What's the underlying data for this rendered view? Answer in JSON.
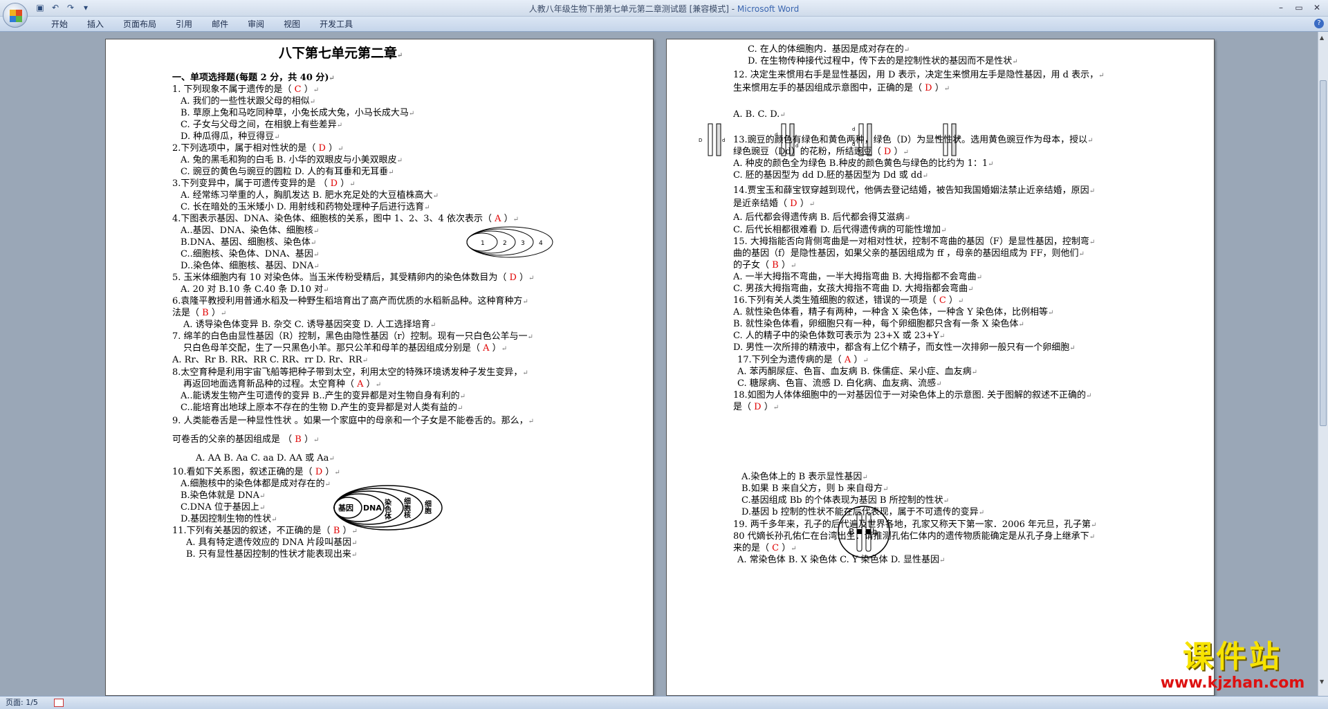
{
  "window": {
    "title": "人教八年级生物下册第七单元第二章测试题 [兼容模式] - ",
    "app": "Microsoft Word"
  },
  "ribbon": {
    "tabs": [
      "开始",
      "插入",
      "页面布局",
      "引用",
      "邮件",
      "审阅",
      "视图",
      "开发工具"
    ]
  },
  "status": {
    "page": "页面: 1/5"
  },
  "watermark": {
    "title": "课件站",
    "url": "www.kjzhan.com"
  },
  "page1": {
    "lines": [
      {
        "t": "八下第七单元第二章",
        "c": "ttl"
      },
      {
        "t": "一、单项选择题(每题 2 分，共 40 分)",
        "c": "sec"
      },
      {
        "t": "1. 下列现象不属于遗传的是（",
        "a": "C",
        "z": "）"
      },
      {
        "t": "A. 我们的一些性状跟父母的相似"
      },
      {
        "t": "B. 草原上兔和马吃同种草，小兔长成大兔，小马长成大马"
      },
      {
        "t": "C. 子女与父母之间，在相貌上有些差异"
      },
      {
        "t": "D. 种瓜得瓜，种豆得豆"
      },
      {
        "t": "2.下列选项中，属于相对性状的是（",
        "a": "D",
        "z": "）"
      },
      {
        "t": "A. 兔的黑毛和狗的白毛          B.  小华的双眼皮与小美双眼皮"
      },
      {
        "t": "C. 豌豆的黄色与豌豆的圆粒        D.  人的有耳垂和无耳垂"
      },
      {
        "t": "3.下列变异中，属于可遗传变异的是 （",
        "a": "D",
        "z": "）"
      },
      {
        "t": "A. 经常练习举重的人，胸肌发达       B. 肥水充足处的大豆植株高大"
      },
      {
        "t": "C. 长在暗处的玉米矮小             D. 用射线和药物处理种子后进行选育"
      },
      {
        "t": "4.下图表示基因、DNA、染色体、细胞核的关系，图中 1、2、3、4 依次表示（",
        "a": "A",
        "z": "）"
      },
      {
        "t": "A..基因、DNA、染色体、细胞核"
      },
      {
        "t": "B.DNA、基因、细胞核、染色体"
      },
      {
        "t": "C..细胞核、染色体、DNA、基因"
      },
      {
        "t": "D..染色体、细胞核、基因、DNA"
      },
      {
        "t": "5. 玉米体细胞内有 10 对染色体。当玉米传粉受精后，其受精卵内的染色体数目为（",
        "a": "D",
        "z": "）"
      },
      {
        "t": "A. 20 对        B.10 条        C.40 条        D.10 对"
      },
      {
        "t": "6.袁隆平教授利用普通水稻及一种野生稻培育出了高产而优质的水稻新品种。这种育种方"
      },
      {
        "t": "法是（",
        "a": "B",
        "z": "）"
      },
      {
        "t": "A. 诱导染色体变异      B. 杂交       C. 诱导基因突变       D. 人工选择培育"
      },
      {
        "t": "7. 绵羊的白色由显性基因（R）控制，黑色由隐性基因（r）控制。现有一只白色公羊与一"
      },
      {
        "t": "只白色母羊交配，生了一只黑色小羊。那只公羊和母羊的基因组成分别是（",
        "a": "A",
        "z": "）"
      },
      {
        "t": "A. Rr、Rr          B. RR、RR          C. RR、rr          D. Rr、RR"
      },
      {
        "t": "8.太空育种是利用宇宙飞船等把种子带到太空，利用太空的特殊环境诱发种子发生变异，"
      },
      {
        "t": "再返回地面选育新品种的过程。太空育种（",
        "a": "A",
        "z": "）"
      },
      {
        "t": "A..能诱发生物产生可遗传的变异             B..产生的变异都是对生物自身有利的"
      },
      {
        "t": "C..能培育出地球上原本不存在的生物         D.产生的变异都是对人类有益的"
      },
      {
        "t": "9. 人类能卷舌是一种显性性状 。如果一个家庭中的母亲和一个子女是不能卷舌的。那么，"
      },
      {
        "t": "可卷舌的父亲的基因组成是       （",
        "a": "B",
        "z": "）"
      },
      {
        "t": "A.  AA             B. Aa            C.  aa             D. AA 或 Aa"
      },
      {
        "t": "10.看如下关系图，叙述正确的是（",
        "a": "D",
        "z": "）"
      },
      {
        "t": "A.细胞核中的染色体都是成对存在的"
      },
      {
        "t": "B.染色体就是 DNA"
      },
      {
        "t": "C.DNA 位于基因上"
      },
      {
        "t": "D.基因控制生物的性状"
      },
      {
        "t": "11.下列有关基因的叙述，不正确的是（",
        "a": "B",
        "z": "）"
      },
      {
        "t": "A. 具有特定遗传效应的 DNA 片段叫基因"
      },
      {
        "t": "B. 只有显性基因控制的性状才能表现出来"
      }
    ],
    "fig4": [
      "1",
      "2",
      "3",
      "4"
    ],
    "fig10": [
      "基因",
      "DNA",
      "染色体",
      "细胞核",
      "细胞"
    ]
  },
  "page2": {
    "lines": [
      {
        "t": "C. 在人的体细胞内．基因是成对存在的"
      },
      {
        "t": "D. 在生物传种接代过程中，传下去的是控制性状的基因而不是性状"
      },
      {
        "t": "12. 决定生来惯用右手是显性基因，用 D 表示，决定生来惯用左手是隐性基因，用 d 表示，"
      },
      {
        "t": "生来惯用左手的基因组成示意图中，正确的是（",
        "a": "D",
        "z": "）"
      },
      {
        "t": "A.               B.               C.               D."
      },
      {
        "t": "13.豌豆的颜色有绿色和黄色两种，绿色（D）为显性性状。选用黄色豌豆作为母本，授以"
      },
      {
        "t": "绿色豌豆（Dd）的花粉，所结豌豆（",
        "a": "D",
        "z": "）"
      },
      {
        "t": "A. 种皮的颜色全为绿色                          B.种皮的颜色黄色与绿色的比约为 1：1"
      },
      {
        "t": "C. 胚的基因型为 dd                             D.胚的基因型为 Dd 或 dd"
      },
      {
        "t": "14.贾宝玉和薛宝钗穿越到现代，他俩去登记结婚，被告知我国婚姻法禁止近亲结婚，原因"
      },
      {
        "t": "是近亲结婚（",
        "a": "D",
        "z": "）"
      },
      {
        "t": "A. 后代都会得遗传病                 B. 后代都会得艾滋病"
      },
      {
        "t": "C. 后代长相都很难看                 D. 后代得遗传病的可能性增加"
      },
      {
        "t": "15. 大拇指能否向背侧弯曲是一对相对性状，控制不弯曲的基因（F）是显性基因，控制弯"
      },
      {
        "t": "曲的基因（f）是隐性基因，如果父亲的基因组成为  ff   ，母亲的基因组成为 FF，则他们"
      },
      {
        "t": "的子女（",
        "a": "B",
        "z": "）"
      },
      {
        "t": "A. 一半大拇指不弯曲，一半大拇指弯曲      B. 大拇指都不会弯曲"
      },
      {
        "t": "C. 男孩大拇指弯曲，女孩大拇指不弯曲      D. 大拇指都会弯曲"
      },
      {
        "t": "16.下列有关人类生殖细胞的叙述，错误的一项是（",
        "a": "C",
        "z": "）"
      },
      {
        "t": "A. 就性染色体看，精子有两种，一种含 X 染色体，一种含 Y 染色体，比例相等"
      },
      {
        "t": "B. 就性染色体看，卵细胞只有一种，每个卵细胞都只含有一条 X 染色体"
      },
      {
        "t": "C. 人的精子中的染色体数可表示为 23+X 或 23+Y"
      },
      {
        "t": "D. 男性一次所排的精液中，都含有上亿个精子，而女性一次排卵一般只有一个卵细胞"
      },
      {
        "t": "17.下列全为遗传病的是（",
        "a": "A",
        "z": "）"
      },
      {
        "t": "A. 苯丙酮尿症、色盲、血友病                             B. 侏儒症、呆小症、血友病"
      },
      {
        "t": "C. 糖尿病、色盲、流感                                   D. 白化病、血友病、流感"
      },
      {
        "t": "18.如图为人体体细胞中的一对基因位于一对染色体上的示意图. 关于图解的叙述不正确的"
      },
      {
        "t": "是（",
        "a": "D",
        "z": "）"
      },
      {
        "t": "A.染色体上的 B 表示显性基因"
      },
      {
        "t": "B.如果 B 来自父方，则 b 来自母方"
      },
      {
        "t": "C.基因组成 Bb 的个体表现为基因 B 所控制的性状"
      },
      {
        "t": "D.基因 b 控制的性状不能在后代表现，属于不可遗传的变异"
      },
      {
        "t": "19. 两千多年来，孔子的后代遍及世界各地，孔家又称天下第一家．2006 年元旦，孔子第"
      },
      {
        "t": "80 代嫡长孙孔佑仁在台湾出生．请推测孔佑仁体内的遗传物质能确定是从孔子身上继承下"
      },
      {
        "t": "来的是（",
        "a": "C",
        "z": "）"
      },
      {
        "t": "A. 常染色体      B. X 染色体      C. Y 染色体      D. 显性基因"
      }
    ],
    "fig12": [
      "D",
      "d"
    ],
    "fig18": [
      "B",
      "b"
    ]
  }
}
